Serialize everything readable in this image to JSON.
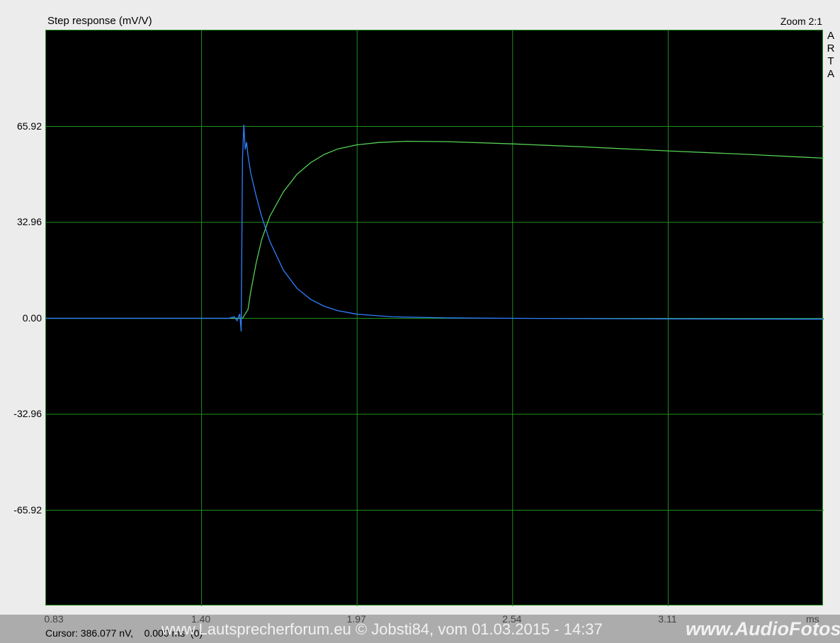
{
  "header": {
    "title": "Step response (mV/V)",
    "zoom": "Zoom 2:1",
    "brand_vertical": [
      "A",
      "R",
      "T",
      "A"
    ]
  },
  "footer": {
    "cursor": "Cursor: 386.077 nV,    0.000 ms  (0)",
    "watermark": "www.Lautsprecherforum.eu © Jobsti84, vom 01.03.2015 - 14:37",
    "brand": "www.AudioFotos.eu"
  },
  "colors": {
    "background": "#000000",
    "grid": "#1f8f1f",
    "green_trace": "#54d154",
    "blue_trace": "#2f7fff"
  },
  "chart_data": {
    "type": "line",
    "title": "Step response (mV/V)",
    "xlabel": "ms",
    "ylabel": "",
    "xlim": [
      0.83,
      3.68
    ],
    "ylim": [
      -98.88,
      98.88
    ],
    "x_ticks": [
      0.83,
      1.4,
      1.97,
      2.54,
      3.11
    ],
    "x_tick_labels": [
      "0.83",
      "1.40",
      "1.97",
      "2.54",
      "3.11"
    ],
    "y_ticks": [
      65.92,
      32.96,
      0.0,
      -32.96,
      -65.92
    ],
    "y_tick_labels": [
      "65.92",
      "32.96",
      "0.00",
      "-32.96",
      "-65.92"
    ],
    "grid": true,
    "series": [
      {
        "color": "#54d154",
        "x": [
          0.83,
          1.4,
          1.55,
          1.57,
          1.58,
          1.6,
          1.62,
          1.65,
          1.7,
          1.75,
          1.8,
          1.85,
          1.9,
          1.97,
          2.05,
          2.15,
          2.3,
          2.54,
          2.8,
          3.11,
          3.4,
          3.68
        ],
        "y": [
          0.0,
          0.0,
          0.0,
          3.0,
          9.0,
          19.0,
          27.0,
          35.0,
          43.5,
          49.5,
          53.5,
          56.3,
          58.2,
          59.6,
          60.4,
          60.8,
          60.7,
          59.9,
          58.9,
          57.5,
          56.3,
          55.0
        ]
      },
      {
        "color": "#2f7fff",
        "x": [
          0.83,
          1.5,
          1.52,
          1.53,
          1.54,
          1.545,
          1.55,
          1.555,
          1.56,
          1.565,
          1.57,
          1.58,
          1.6,
          1.62,
          1.65,
          1.7,
          1.75,
          1.8,
          1.85,
          1.9,
          1.97,
          2.1,
          2.3,
          2.54,
          3.11,
          3.68
        ],
        "y": [
          0.0,
          0.0,
          0.5,
          -0.8,
          1.5,
          -4.5,
          55.0,
          66.5,
          58.0,
          60.5,
          56.0,
          50.0,
          42.0,
          35.0,
          26.5,
          16.5,
          10.3,
          6.5,
          4.1,
          2.6,
          1.4,
          0.5,
          0.15,
          0.0,
          -0.2,
          -0.3
        ]
      }
    ]
  }
}
